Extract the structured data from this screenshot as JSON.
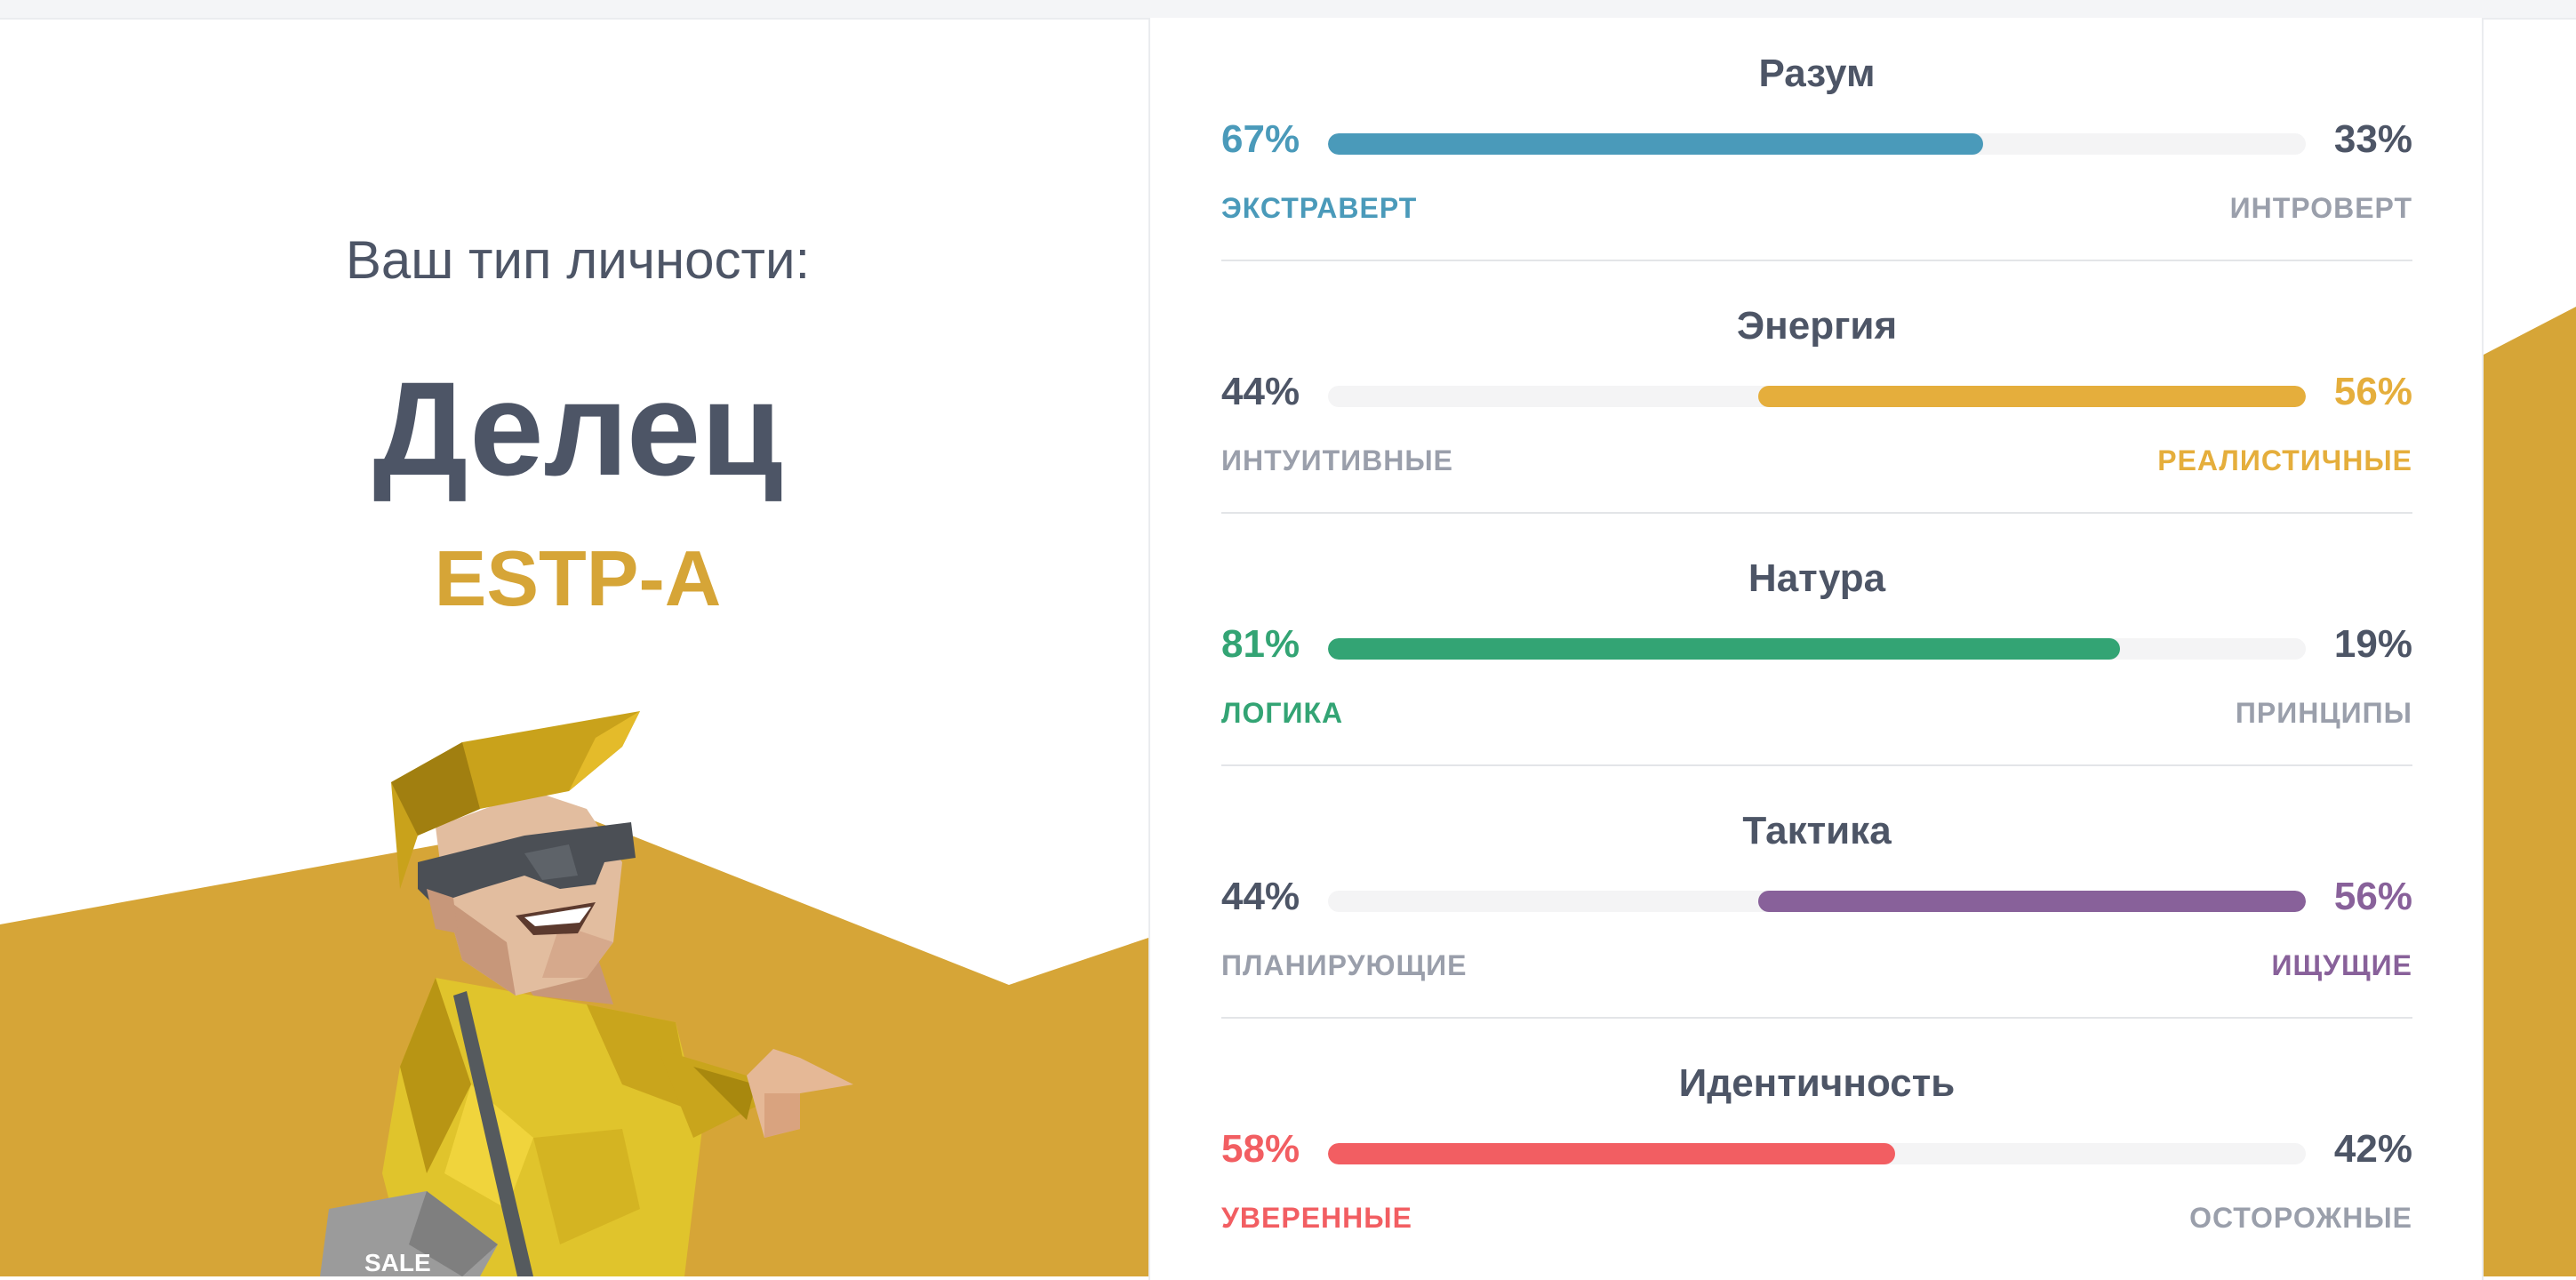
{
  "result": {
    "intro": "Ваш тип личности:",
    "type_name": "Делец",
    "type_code": "ESTP-A",
    "character_sign": "SALE"
  },
  "colors": {
    "accent": "#d6a537",
    "text": "#4d5566",
    "muted": "#9a9fab",
    "mind": "#4a9aba",
    "energy": "#e5ae3c",
    "nature": "#33a474",
    "tactics": "#88619a",
    "identity": "#f25e62"
  },
  "traits": [
    {
      "title": "Разум",
      "left_pct": "67%",
      "right_pct": "33%",
      "left_label": "ЭКСТРАВЕРТ",
      "right_label": "ИНТРОВЕРТ",
      "dominant": "left",
      "dominant_fraction": 0.67,
      "color": "#4a9aba"
    },
    {
      "title": "Энергия",
      "left_pct": "44%",
      "right_pct": "56%",
      "left_label": "ИНТУИТИВНЫЕ",
      "right_label": "РЕАЛИСТИЧНЫЕ",
      "dominant": "right",
      "dominant_fraction": 0.56,
      "color": "#e5ae3c"
    },
    {
      "title": "Натура",
      "left_pct": "81%",
      "right_pct": "19%",
      "left_label": "ЛОГИКА",
      "right_label": "ПРИНЦИПЫ",
      "dominant": "left",
      "dominant_fraction": 0.81,
      "color": "#33a474"
    },
    {
      "title": "Тактика",
      "left_pct": "44%",
      "right_pct": "56%",
      "left_label": "ПЛАНИРУЮЩИЕ",
      "right_label": "ИЩУЩИЕ",
      "dominant": "right",
      "dominant_fraction": 0.56,
      "color": "#88619a"
    },
    {
      "title": "Идентичность",
      "left_pct": "58%",
      "right_pct": "42%",
      "left_label": "УВЕРЕННЫЕ",
      "right_label": "ОСТОРОЖНЫЕ",
      "dominant": "left",
      "dominant_fraction": 0.58,
      "color": "#f25e62"
    }
  ]
}
